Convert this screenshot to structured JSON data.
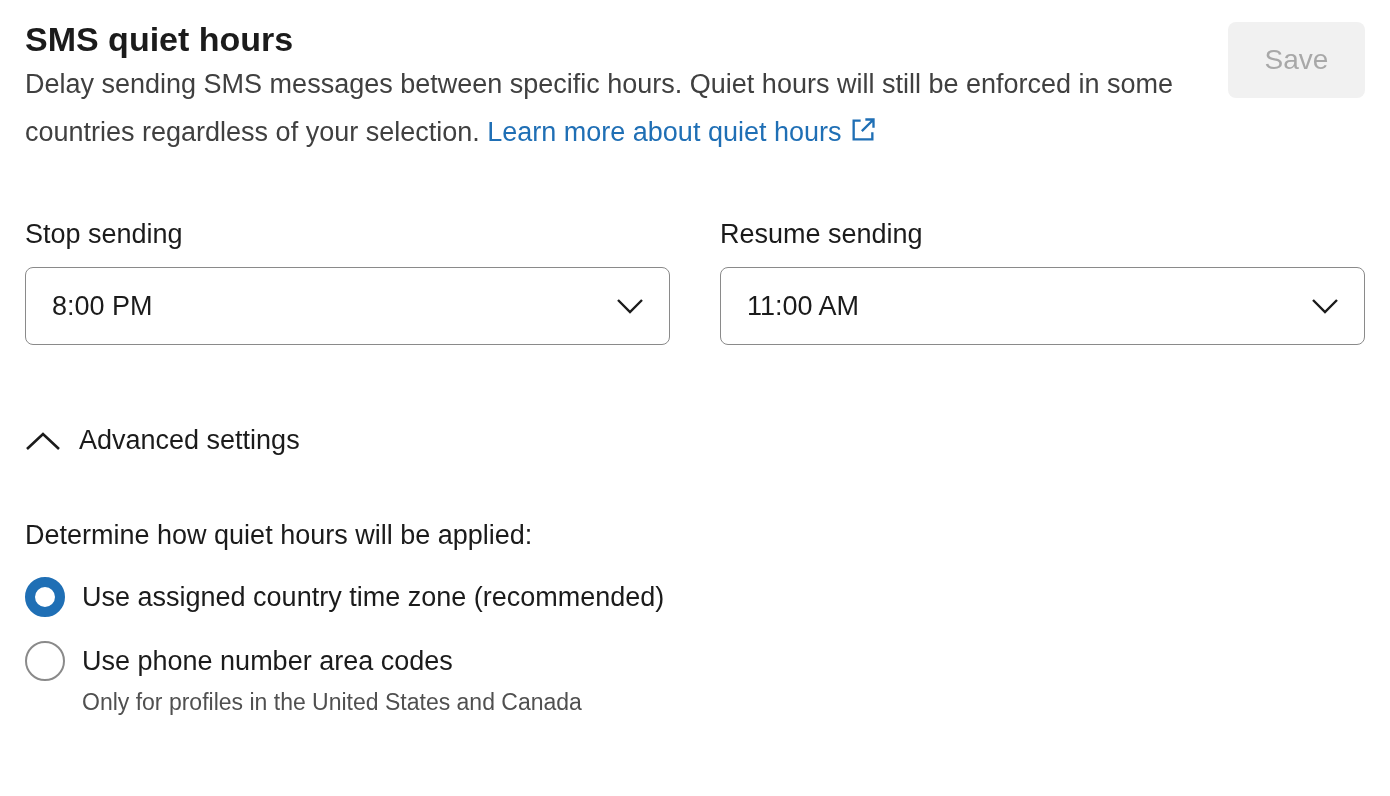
{
  "header": {
    "title": "SMS quiet hours",
    "description": "Delay sending SMS messages between specific hours. Quiet hours will still be enforced in some countries regardless of your selection.",
    "link": "Learn more about quiet hours",
    "save_button": {
      "label": "Save",
      "disabled": true
    }
  },
  "fields": [
    {
      "label": "Stop sending",
      "value": "8:00 PM"
    },
    {
      "label": "Resume sending",
      "value": "11:00 AM"
    }
  ],
  "advanced": {
    "label": "Advanced settings",
    "expanded": true,
    "prompt": "Determine how quiet hours will be applied:",
    "options": [
      {
        "label": "Use assigned country time zone (recommended)",
        "selected": true
      },
      {
        "label": "Use phone number area codes",
        "selected": false,
        "hint": "Only for profiles in the United States and Canada"
      }
    ]
  }
}
